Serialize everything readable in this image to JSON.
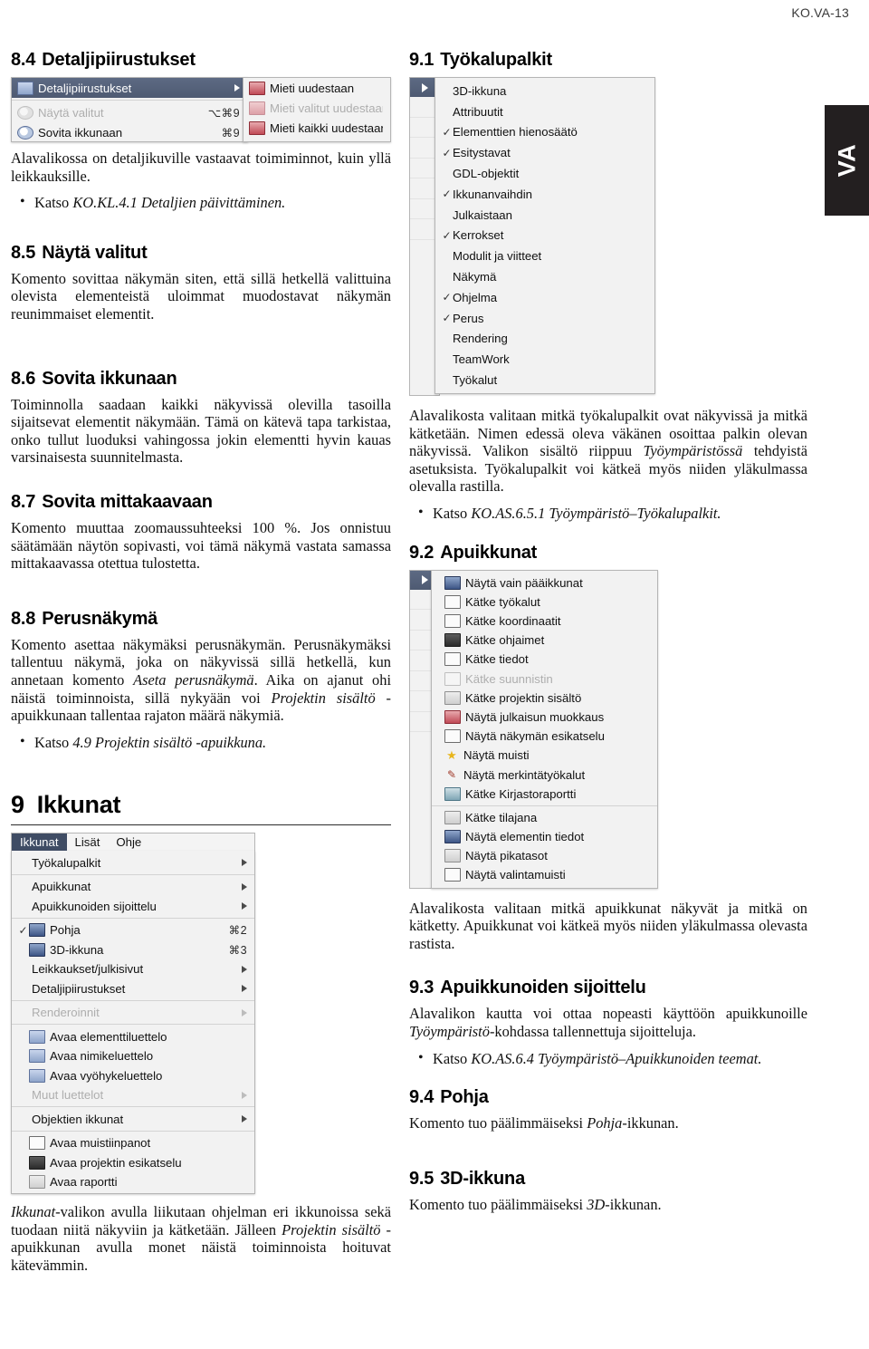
{
  "page": {
    "header": "KO.VA-13",
    "thumb_tab": "VA"
  },
  "left": {
    "s84": {
      "number": "8.4",
      "title": "Detaljipiirustukset",
      "body": "Alavalikossa on detaljikuville vastaavat toimiminnot, kuin yllä leikkauksille.",
      "bullet_prefix": "Katso ",
      "bullet_ref": "KO.KL.4.1 Detaljien päivittäminen."
    },
    "shot1": {
      "parent_items": [
        {
          "icon": "detail-drawing-icon",
          "label": "Detaljipiirustukset",
          "key": "",
          "arrow": true,
          "selected": true,
          "dim": false
        },
        {
          "icon": "magnifier-icon",
          "label": "Näytä valitut",
          "key": "⌥⌘9",
          "arrow": false,
          "selected": false,
          "dim": true
        },
        {
          "icon": "magnifier-fit-icon",
          "label": "Sovita ikkunaan",
          "key": "⌘9",
          "arrow": false,
          "selected": false,
          "dim": false
        }
      ],
      "child_items": [
        {
          "icon": "rebuild-icon",
          "label": "Mieti uudestaan",
          "dim": false
        },
        {
          "icon": "rebuild-selected-icon",
          "label": "Mieti valitut uudestaan",
          "dim": true
        },
        {
          "icon": "rebuild-all-icon",
          "label": "Mieti kaikki uudestaan",
          "dim": false
        }
      ]
    },
    "s85": {
      "number": "8.5",
      "title": "Näytä valitut",
      "body": "Komento sovittaa näkymän siten, että sillä hetkellä valittuina olevista elementeistä uloimmat muodostavat näkymän reunimmaiset elementit."
    },
    "s86": {
      "number": "8.6",
      "title": "Sovita ikkunaan",
      "body_1": "Toiminnolla saadaan kaikki näkyvissä olevilla tasoilla sijaitsevat elementit näkymään. Tämä on kätevä tapa tarkistaa, onko tullut luoduksi vahingossa jokin elementti hyvin kauas varsinaisesta suunnitelmasta."
    },
    "s87": {
      "number": "8.7",
      "title": "Sovita mittakaavaan",
      "body": "Komento muuttaa zoomaussuhteeksi 100 %. Jos onnistuu säätämään näytön sopivasti, voi tämä näkymä vastata samassa mittakaavassa otettua tulostetta."
    },
    "s88": {
      "number": "8.8",
      "title": "Perusnäkymä",
      "body_a": "Komento asettaa näkymäksi perusnäkymän. Perusnäkymäksi tallentuu näkymä, joka on näkyvissä sillä hetkellä, kun annetaan komento ",
      "body_em1": "Aseta perusnäkymä",
      "body_b": ". Aika on ajanut ohi näistä toiminnoista, sillä nykyään voi ",
      "body_em2": "Projektin sisältö",
      "body_c": " -apuikkunaan tallentaa rajaton määrä näkymiä.",
      "bullet_prefix": "Katso ",
      "bullet_ref": "4.9 Projektin sisältö -apuikkuna."
    },
    "chapter9": {
      "number": "9",
      "title": "Ikkunat"
    },
    "shot3": {
      "menubar": [
        {
          "label": "Ikkunat",
          "active": true
        },
        {
          "label": "Lisät",
          "active": false
        },
        {
          "label": "Ohje",
          "active": false
        }
      ],
      "items": [
        {
          "kind": "item",
          "icon": "",
          "check": "",
          "label": "Työkalupalkit",
          "key": "",
          "arrow": true,
          "dim": false
        },
        {
          "kind": "sep"
        },
        {
          "kind": "item",
          "icon": "",
          "check": "",
          "label": "Apuikkunat",
          "key": "",
          "arrow": true,
          "dim": false
        },
        {
          "kind": "item",
          "icon": "",
          "check": "",
          "label": "Apuikkunoiden sijoittelu",
          "key": "",
          "arrow": true,
          "dim": false
        },
        {
          "kind": "sep"
        },
        {
          "kind": "item",
          "icon": "floorplan-icon",
          "check": "✓",
          "label": "Pohja",
          "key": "⌘2",
          "arrow": false,
          "dim": false
        },
        {
          "kind": "item",
          "icon": "3d-window-icon",
          "check": "",
          "label": "3D-ikkuna",
          "key": "⌘3",
          "arrow": false,
          "dim": false
        },
        {
          "kind": "item",
          "icon": "",
          "check": "",
          "label": "Leikkaukset/julkisivut",
          "key": "",
          "arrow": true,
          "dim": false
        },
        {
          "kind": "item",
          "icon": "",
          "check": "",
          "label": "Detaljipiirustukset",
          "key": "",
          "arrow": true,
          "dim": false
        },
        {
          "kind": "sep"
        },
        {
          "kind": "item",
          "icon": "",
          "check": "",
          "label": "Renderoinnit",
          "key": "",
          "arrow": true,
          "dim": true
        },
        {
          "kind": "sep"
        },
        {
          "kind": "item",
          "icon": "element-list-icon",
          "check": "",
          "label": "Avaa elementtiluettelo",
          "key": "",
          "arrow": false,
          "dim": false
        },
        {
          "kind": "item",
          "icon": "component-list-icon",
          "check": "",
          "label": "Avaa nimikeluettelo",
          "key": "",
          "arrow": false,
          "dim": false
        },
        {
          "kind": "item",
          "icon": "zone-list-icon",
          "check": "",
          "label": "Avaa vyöhykeluettelo",
          "key": "",
          "arrow": false,
          "dim": false
        },
        {
          "kind": "item",
          "icon": "",
          "check": "",
          "label": "Muut luettelot",
          "key": "",
          "arrow": true,
          "dim": true
        },
        {
          "kind": "sep"
        },
        {
          "kind": "item",
          "icon": "",
          "check": "",
          "label": "Objektien ikkunat",
          "key": "",
          "arrow": true,
          "dim": false
        },
        {
          "kind": "sep"
        },
        {
          "kind": "item",
          "icon": "notes-icon",
          "check": "",
          "label": "Avaa muistiinpanot",
          "key": "",
          "arrow": false,
          "dim": false
        },
        {
          "kind": "item",
          "icon": "project-preview-icon",
          "check": "",
          "label": "Avaa projektin esikatselu",
          "key": "",
          "arrow": false,
          "dim": false
        },
        {
          "kind": "item",
          "icon": "report-icon",
          "check": "",
          "label": "Avaa raportti",
          "key": "",
          "arrow": false,
          "dim": false
        }
      ]
    },
    "caption": {
      "em1": "Ikkunat",
      "a": "-valikon avulla liikutaan ohjelman eri ikkunoissa sekä tuodaan niitä näkyviin ja kätketään. Jälleen ",
      "em2": "Projektin sisältö",
      "b": " -apuikkunan avulla monet näistä toiminnoista hoituvat kätevämmin."
    }
  },
  "right": {
    "s91": {
      "number": "9.1",
      "title": "Työkalupalkit",
      "body": "Alavalikosta valitaan mitkä työkalupalkit ovat näkyvissä ja mitkä kätketään. Nimen edessä oleva väkänen osoittaa palkin olevan näkyvissä. Valikon sisältö riippuu ",
      "body_em": "Työympäristössä",
      "body_b": " tehdyistä asetuksista. Työkalupalkit voi kätkeä myös niiden yläkulmassa olevalla rastilla.",
      "bullet_prefix": "Katso ",
      "bullet_ref": "KO.AS.6.5.1 Työympäristö–Työkalupalkit."
    },
    "shot_toolbars": {
      "items": [
        {
          "check": "",
          "label": "3D-ikkuna"
        },
        {
          "check": "",
          "label": "Attribuutit"
        },
        {
          "check": "✓",
          "label": "Elementtien hienosäätö"
        },
        {
          "check": "✓",
          "label": "Esitystavat"
        },
        {
          "check": "",
          "label": "GDL-objektit"
        },
        {
          "check": "✓",
          "label": "Ikkunanvaihdin"
        },
        {
          "check": "",
          "label": "Julkaistaan"
        },
        {
          "check": "✓",
          "label": "Kerrokset"
        },
        {
          "check": "",
          "label": "Modulit ja viitteet"
        },
        {
          "check": "",
          "label": "Näkymä"
        },
        {
          "check": "✓",
          "label": "Ohjelma"
        },
        {
          "check": "✓",
          "label": "Perus"
        },
        {
          "check": "",
          "label": "Rendering"
        },
        {
          "check": "",
          "label": "TeamWork"
        },
        {
          "check": "",
          "label": "Työkalut"
        }
      ]
    },
    "s92": {
      "number": "9.2",
      "title": "Apuikkunat",
      "body": "Alavalikosta valitaan mitkä apuikkunat näkyvät ja mitkä on kätketty. Apuikkunat voi kätkeä myös niiden yläkulmassa olevasta rastista."
    },
    "shot_palettes": {
      "items": [
        {
          "kind": "item",
          "icon": "main-windows-icon",
          "label": "Näytä vain pääikkunat",
          "dim": false
        },
        {
          "kind": "item",
          "icon": "toolbox-icon",
          "label": "Kätke työkalut",
          "dim": false
        },
        {
          "kind": "item",
          "icon": "coordinates-icon",
          "label": "Kätke koordinaatit",
          "dim": false
        },
        {
          "kind": "item",
          "icon": "controls-icon",
          "label": "Kätke ohjaimet",
          "dim": false
        },
        {
          "kind": "item",
          "icon": "info-icon",
          "label": "Kätke tiedot",
          "dim": false
        },
        {
          "kind": "item",
          "icon": "navigator-icon",
          "label": "Kätke suunnistin",
          "dim": true
        },
        {
          "kind": "item",
          "icon": "project-content-icon",
          "label": "Kätke projektin sisältö",
          "dim": false
        },
        {
          "kind": "item",
          "icon": "publisher-icon",
          "label": "Näytä julkaisun muokkaus",
          "dim": false
        },
        {
          "kind": "item",
          "icon": "view-preview-icon",
          "label": "Näytä näkymän esikatselu",
          "dim": false
        },
        {
          "kind": "item",
          "icon": "favorites-star-icon",
          "label": "Näytä muisti",
          "dim": false
        },
        {
          "kind": "item",
          "icon": "markup-tools-icon",
          "label": "Näytä merkintätyökalut",
          "dim": false
        },
        {
          "kind": "item",
          "icon": "library-report-icon",
          "label": "Kätke Kirjastoraportti",
          "dim": false
        },
        {
          "kind": "sep"
        },
        {
          "kind": "item",
          "icon": "status-bar-icon",
          "label": "Kätke tilajana",
          "dim": false
        },
        {
          "kind": "item",
          "icon": "element-info-icon",
          "label": "Näytä elementin tiedot",
          "dim": false
        },
        {
          "kind": "item",
          "icon": "quick-layers-icon",
          "label": "Näytä pikatasot",
          "dim": false
        },
        {
          "kind": "item",
          "icon": "selection-memory-icon",
          "label": "Näytä valintamuisti",
          "dim": false
        }
      ]
    },
    "s93": {
      "number": "9.3",
      "title": "Apuikkunoiden sijoittelu",
      "body_a": "Alavalikon kautta voi ottaa nopeasti käyttöön apuikkunoille ",
      "body_em": "Työympäristö",
      "body_b": "-kohdassa tallennettuja sijoitteluja.",
      "bullet_prefix": "Katso ",
      "bullet_ref": "KO.AS.6.4 Työympäristö–Apuikkunoiden teemat."
    },
    "s94": {
      "number": "9.4",
      "title": "Pohja",
      "body_a": "Komento tuo päälimmäiseksi ",
      "body_em": "Pohja",
      "body_b": "-ikkunan."
    },
    "s95": {
      "number": "9.5",
      "title": "3D-ikkuna",
      "body_a": "Komento tuo päälimmäiseksi ",
      "body_em": "3D",
      "body_b": "-ikkunan."
    }
  }
}
